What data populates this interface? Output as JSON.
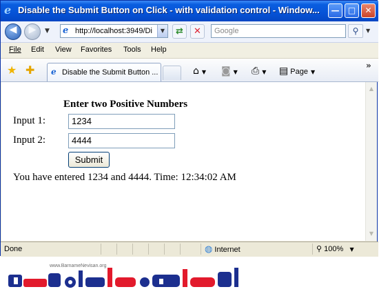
{
  "window": {
    "title": "Disable the Submit Button on Click - with validation control - Window...",
    "minimize_glyph": "—",
    "maximize_glyph": "□",
    "close_glyph": "✕"
  },
  "toolbar": {
    "address_value": "http://localhost:3949/Di:",
    "search_placeholder": "Google",
    "back_icon": "arrow-left-icon",
    "forward_icon": "arrow-right-icon"
  },
  "menu": [
    "File",
    "Edit",
    "View",
    "Favorites",
    "Tools",
    "Help"
  ],
  "tabs": {
    "active_label": "Disable the Submit Button ...",
    "page_label": "Page",
    "overflow_glyph": "»"
  },
  "form": {
    "heading": "Enter two Positive Numbers",
    "input1_label": "Input 1:",
    "input1_value": "1234",
    "input2_label": "Input 2:",
    "input2_value": "4444",
    "submit_label": "Submit",
    "result_text": "You have entered 1234 and 4444. Time: 12:34:02 AM"
  },
  "status": {
    "done": "Done",
    "zone": "Internet",
    "zoom": "100%"
  },
  "logo": {
    "site_url": "www.BarnameNevisan.org",
    "colors": {
      "blue": "#1c2f8f",
      "red": "#e21a2c"
    }
  }
}
